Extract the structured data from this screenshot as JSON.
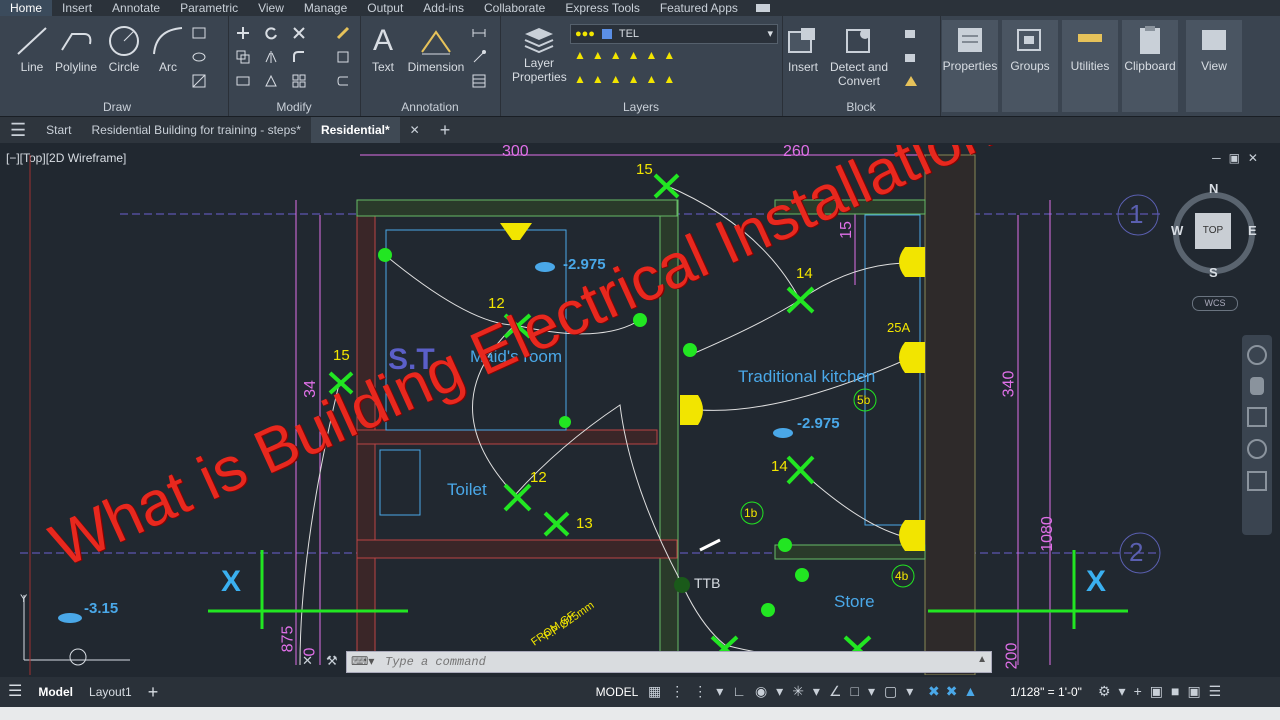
{
  "ribbon_tabs": [
    "Home",
    "Insert",
    "Annotate",
    "Parametric",
    "View",
    "Manage",
    "Output",
    "Add-ins",
    "Collaborate",
    "Express Tools",
    "Featured Apps"
  ],
  "ribbon": {
    "draw": {
      "title": "Draw",
      "line": "Line",
      "polyline": "Polyline",
      "circle": "Circle",
      "arc": "Arc"
    },
    "modify": {
      "title": "Modify"
    },
    "annotation": {
      "title": "Annotation",
      "text": "Text",
      "dimension": "Dimension"
    },
    "layers": {
      "title": "Layers",
      "layer_properties_l1": "Layer",
      "layer_properties_l2": "Properties",
      "current_layer": "TEL"
    },
    "block": {
      "title": "Block",
      "insert": "Insert",
      "detect_l1": "Detect and",
      "detect_l2": "Convert"
    },
    "properties": "Properties",
    "groups": "Groups",
    "utilities": "Utilities",
    "clipboard": "Clipboard",
    "view": "View"
  },
  "file_tabs": {
    "start": "Start",
    "file1": "Residential Building for training - steps*",
    "file2": "Residential*"
  },
  "viewport_label": "[−][Top][2D Wireframe]",
  "viewcube": {
    "n": "N",
    "s": "S",
    "e": "E",
    "w": "W",
    "top": "TOP",
    "wcs": "WCS"
  },
  "drawing": {
    "dims": {
      "d300": "300",
      "d260": "260",
      "d340a": "34",
      "d340b": "340",
      "d1080": "1080",
      "d15": "15",
      "d875": "875",
      "d200": "200",
      "d0": "0"
    },
    "rooms": {
      "st": "S.T",
      "maid": "Maid's room",
      "kitchen": "Traditional kitchen",
      "toilet": "Toilet",
      "store": "Store"
    },
    "levels": {
      "l1": "-2.975",
      "l2": "-2.975",
      "l3": "-3.15"
    },
    "labels": {
      "n15a": "15",
      "n15b": "15",
      "n14a": "14",
      "n14b": "14",
      "n12a": "12",
      "n12b": "12",
      "n12c": "12",
      "n13": "13",
      "a25": "25A",
      "c5b": "5b",
      "c1b": "1b",
      "c4b": "4b",
      "ttb": "TTB",
      "fromgf": "FROM GF",
      "pp": "P.P Ø25mm"
    },
    "grid": {
      "g1": "1",
      "g2": "2",
      "xl": "X",
      "xr": "X",
      "ylab": "Y"
    }
  },
  "overlay_title": "What is Building Electrical Installation",
  "command": {
    "placeholder": "Type a command"
  },
  "status": {
    "model_tab": "Model",
    "layout_tab": "Layout1",
    "model_btn": "MODEL",
    "scale": "1/128\" = 1'-0\""
  },
  "colors": {
    "accent": "#3b7dd8",
    "fixture_green": "#22e622",
    "fixture_yellow": "#f2e500",
    "dim_magenta": "#e070e8",
    "room_cyan": "#4aa8e8",
    "overlay_red": "#e8281e"
  }
}
